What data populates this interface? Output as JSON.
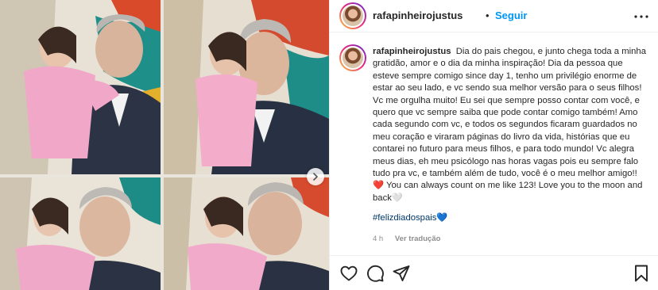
{
  "post": {
    "username": "rafapinheirojustus",
    "separator": "•",
    "follow_label": "Seguir",
    "caption_user": "rafapinheirojustus",
    "caption_text": "Dia do pais chegou, e junto chega toda a minha gratidão, amor e o dia da minha inspiração! Dia da pessoa que esteve sempre comigo since day 1, tenho um privilégio enorme de estar ao seu lado, e vc sendo sua melhor versão para o seus filhos! Vc me orgulha muito! Eu sei que sempre posso contar com você, e quero que vc sempre saiba que pode contar comigo também! Amo cada segundo com vc, e todos os segundos ficaram guardados no meu coração e viraram páginas do livro da vida, histórias que eu contarei no futuro para meus filhos, e para todo mundo! Vc alegra meus dias, eh meu psicólogo nas horas vagas pois eu sempre falo tudo pra vc, e também além de tudo, você é o meu melhor amigo!!",
    "caption_heart": "❤️",
    "caption_text_end": "You can always count on me like 123! Love you to the moon and back🤍",
    "hashtag": "#felizdiadospais",
    "hashtag_heart": "💙",
    "time_ago": "4 h",
    "translate_label": "Ver tradução"
  },
  "icons": {
    "more": "more-options-icon",
    "like": "heart-outline-icon",
    "comment": "comment-bubble-icon",
    "share": "paper-plane-icon",
    "save": "bookmark-icon",
    "next": "chevron-right-icon"
  },
  "colors": {
    "accent": "#0095f6",
    "hashtag": "#00376b",
    "muted": "#8e8e8e",
    "border": "#efefef"
  }
}
